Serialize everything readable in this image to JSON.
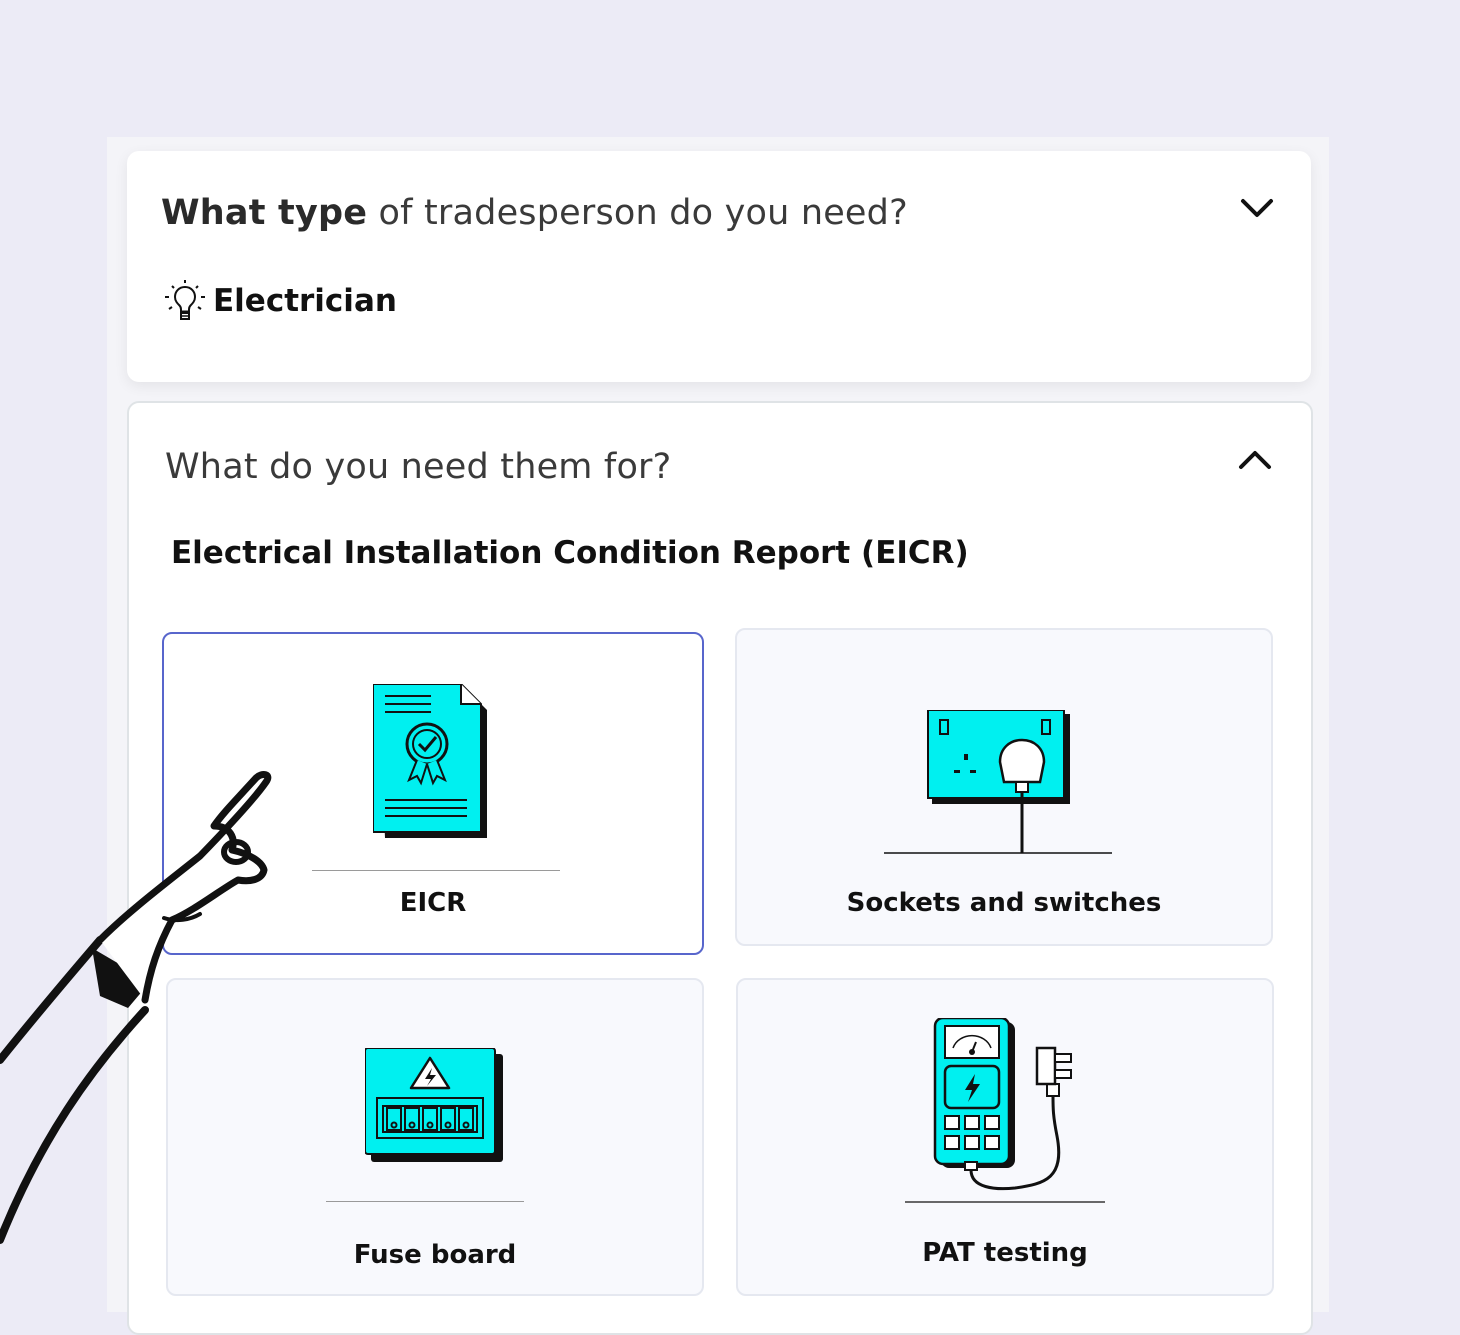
{
  "question1": {
    "title_bold": "What type",
    "title_rest": " of tradesperson do you need?",
    "answer": "Electrician",
    "answer_icon": "lightbulb-icon",
    "toggle_icon": "chevron-down-icon"
  },
  "question2": {
    "title": "What do you need them for?",
    "toggle_icon": "chevron-up-icon",
    "subtitle": "Electrical Installation Condition Report (EICR)",
    "options": [
      {
        "label": "EICR",
        "icon": "certificate-icon",
        "selected": true
      },
      {
        "label": "Sockets and switches",
        "icon": "socket-icon",
        "selected": false
      },
      {
        "label": "Fuse board",
        "icon": "fuse-board-icon",
        "selected": false
      },
      {
        "label": "PAT testing",
        "icon": "pat-tester-icon",
        "selected": false
      }
    ]
  },
  "colors": {
    "background": "#ecebf6",
    "accent_cyan": "#00f0f0",
    "selected_border": "#5866cc"
  }
}
